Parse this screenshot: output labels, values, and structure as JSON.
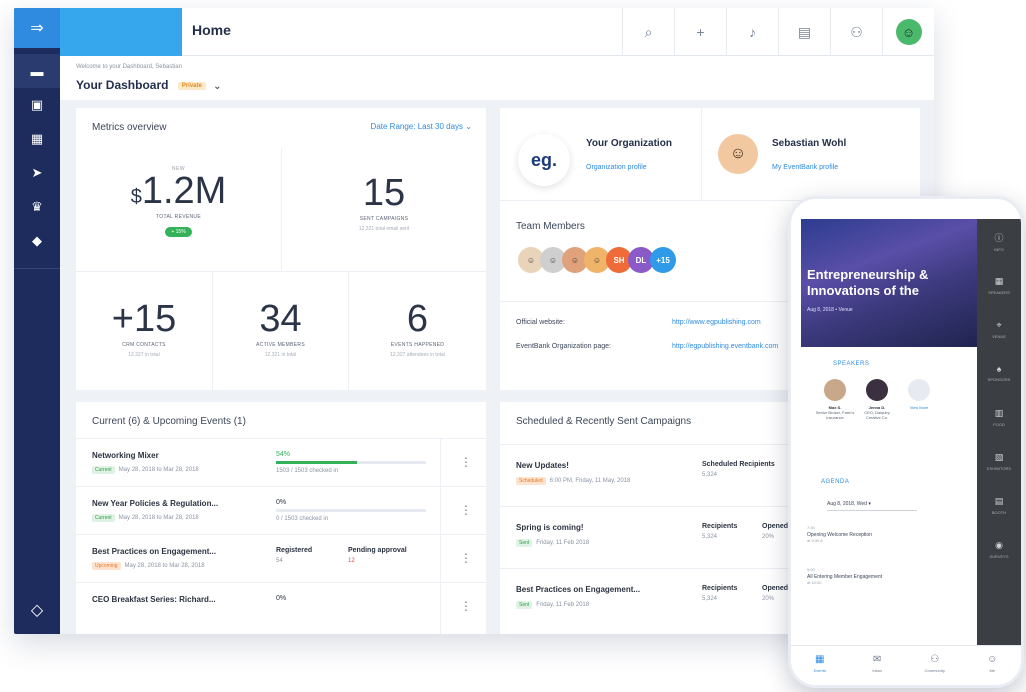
{
  "app": {
    "page_title": "Home",
    "breadcrumb": "Welcome to your Dashboard, Sebastian",
    "dashboard_title": "Your Dashboard",
    "dashboard_badge": "Private"
  },
  "metrics": {
    "title": "Metrics overview",
    "date_range": "Date Range: Last 30 days",
    "revenue": {
      "small": "NEW",
      "currency": "$",
      "value": "1.2M",
      "label": "TOTAL REVENUE",
      "pill": "+ 15%"
    },
    "campaigns": {
      "value": "15",
      "label": "SENT CAMPAIGNS",
      "sub": "12,321 total email sent"
    },
    "contacts": {
      "value": "+15",
      "label": "CRM CONTACTS",
      "sub": "12,327 in total"
    },
    "members": {
      "value": "34",
      "label": "ACTIVE MEMBERS",
      "sub": "12,321 in total"
    },
    "events": {
      "value": "6",
      "label": "EVENTS HAPPENED",
      "sub": "12,327 attendees in total"
    }
  },
  "org": {
    "logo_text": "eg.",
    "name": "Your Organization",
    "link": "Organization profile",
    "user_name": "Sebastian Wohl",
    "user_link": "My EventBank profile",
    "team_title": "Team Members",
    "team_more": [
      "SH",
      "DL",
      "+15"
    ],
    "website_label": "Official website:",
    "website_value": "http://www.egpublishing.com",
    "page_label": "EventBank Organization page:",
    "page_value": "http://egpublishing.eventbank.com"
  },
  "events": {
    "title": "Current (6) & Upcoming Events (1)",
    "rows": [
      {
        "name": "Networking Mixer",
        "tag": "Current",
        "date": "May 28, 2018 to Mar 28, 2018",
        "col1": "54%",
        "col1_sub": "1503 / 1503 checked in",
        "progress": 0.54
      },
      {
        "name": "New Year Policies & Regulation...",
        "tag": "Current",
        "date": "May 28, 2018 to Mar 28, 2018",
        "col1": "0%",
        "col1_sub": "0 / 1503 checked in",
        "progress": 0
      },
      {
        "name": "Best Practices on Engagement...",
        "tag": "Upcoming",
        "date": "May 28, 2018 to Mar 28, 2018",
        "col1": "Registered",
        "col1_sub": "54",
        "col2": "Pending approval",
        "col2_sub": "12"
      },
      {
        "name": "CEO Breakfast Series: Richard...",
        "col1": "0%"
      }
    ]
  },
  "campaigns": {
    "title": "Scheduled & Recently Sent Campaigns",
    "rows": [
      {
        "name": "New Updates!",
        "tag": "Scheduled",
        "date": "6:00 PM, Friday, 11 May, 2018",
        "col1": "Scheduled Recipients",
        "col1_sub": "5,324"
      },
      {
        "name": "Spring is coming!",
        "tag": "Sent",
        "date": "Friday, 11 Feb 2018",
        "col1": "Recipients",
        "col1_sub": "5,324",
        "col2": "Opened",
        "col2_sub": "20%"
      },
      {
        "name": "Best Practices on Engagement...",
        "tag": "Sent",
        "date": "Friday, 11 Feb 2018",
        "col1": "Recipients",
        "col1_sub": "5,324",
        "col2": "Opened",
        "col2_sub": "20%"
      }
    ]
  },
  "phone": {
    "hero_title": "Entrepreneurship & Innovations of the",
    "hero_meta": "Aug 8, 2018  •  Venue",
    "speakers_label": "SPEAKERS",
    "speakers": [
      {
        "name": "Max S.",
        "role": "Senior Broker, Farm's Insurance"
      },
      {
        "name": "Jenna D.",
        "role": "CEO, Daiquiry Creative Co."
      }
    ],
    "view_more": "View More",
    "agenda_label": "AGENDA",
    "date_select": "Aug 8, 2018, Wed",
    "items": [
      {
        "time": "7:30",
        "text": "Opening Welcome Reception",
        "sub": "at 9:30 A"
      },
      {
        "time": "9:00",
        "text": "All Entering Member Engagement",
        "sub": "at 10:00"
      }
    ],
    "rail": [
      "INFO",
      "SPEAKERS",
      "VENUE",
      "SPONSORS",
      "FOOD",
      "EXHIBITORS",
      "BOOTH",
      "SURVEYS"
    ],
    "tabs": [
      "Events",
      "Inbox",
      "Community",
      "Me"
    ]
  },
  "colors": {
    "primary": "#2f8be0",
    "sidebar": "#1d2c5c",
    "success": "#33b25a",
    "warning": "#e07a2b"
  }
}
